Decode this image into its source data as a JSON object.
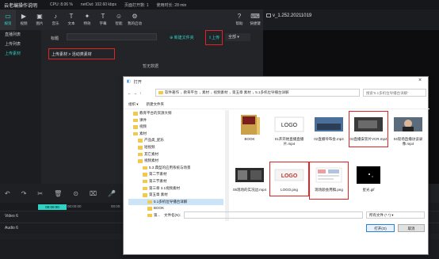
{
  "statusbar": {
    "app_title": "云老编操作说明",
    "cpu": "CPU: 8.06 %",
    "net": "netOut: 102.60 kbps",
    "fps": "页面打开数: 1",
    "time": "使用时长: 28 min"
  },
  "toolbar": {
    "items": [
      {
        "label": "媒资",
        "icon": "media-icon"
      },
      {
        "label": "视频",
        "icon": "video-icon"
      },
      {
        "label": "图片",
        "icon": "image-icon"
      },
      {
        "label": "音乐",
        "icon": "music-icon"
      },
      {
        "label": "文本",
        "icon": "text-icon"
      },
      {
        "label": "特效",
        "icon": "effect-icon"
      },
      {
        "label": "字幕",
        "icon": "subtitle-icon"
      },
      {
        "label": "智能",
        "icon": "ai-icon"
      },
      {
        "label": "我的启动",
        "icon": "start-icon"
      }
    ],
    "help": "帮助",
    "shortcut": "快捷键"
  },
  "preview": {
    "version": "v_1.252.20211019"
  },
  "sidebar": {
    "items": [
      {
        "label": "直播列表",
        "active": false
      },
      {
        "label": "上传列表",
        "active": false
      },
      {
        "label": "上传素材",
        "active": true
      }
    ]
  },
  "main": {
    "title_label": "标题",
    "new_folder": "新建文件夹",
    "upload": "上传",
    "filter": "全部",
    "breadcrumb": "上传素材 > 活动类素材",
    "no_data": "暂无数据"
  },
  "timeline": {
    "time_current": "00:00:00",
    "time_total": "00:00:00",
    "ruler_mark": "00:00:",
    "tracks": [
      "Video 6",
      "Audio 6"
    ]
  },
  "dialog": {
    "title": "打开",
    "path": [
      "软件著作",
      "教育平台",
      "素材",
      "视频素材",
      "第五章 素材",
      "5.1多机位导播台详解"
    ],
    "search_placeholder": "搜索'5.1多机位导播台详解'",
    "organize": "组织 ▾",
    "new_folder": "新建文件夹",
    "nav_items": [
      {
        "label": "教育平台的资源大纲",
        "indent": 2
      },
      {
        "label": "课件",
        "indent": 2
      },
      {
        "label": "视频",
        "indent": 2
      },
      {
        "label": "素材",
        "indent": 2
      },
      {
        "label": "产品类_配乐",
        "indent": 3
      },
      {
        "label": "短视频",
        "indent": 3
      },
      {
        "label": "其它素材",
        "indent": 3
      },
      {
        "label": "视频素材",
        "indent": 3
      },
      {
        "label": "5.3 典型的应用系统与场景",
        "indent": 4
      },
      {
        "label": "第二节素材",
        "indent": 4
      },
      {
        "label": "第三节素材",
        "indent": 4
      },
      {
        "label": "第三章 3.1视频素材",
        "indent": 4
      },
      {
        "label": "第五章 素材",
        "indent": 4
      },
      {
        "label": "5.1多机位导播台详解",
        "indent": 5,
        "selected": true
      },
      {
        "label": "BOOK",
        "indent": 5
      },
      {
        "label": "第...",
        "indent": 5
      }
    ],
    "files": [
      {
        "name": "BOOK",
        "kind": "folder"
      },
      {
        "name": "01开开始直播直播片.mp4",
        "kind": "video"
      },
      {
        "name": "02直播导布会.mp4",
        "kind": "video"
      },
      {
        "name": "03直播安装片VCR.mp4",
        "kind": "video",
        "highlight": true
      },
      {
        "name": "04现场直播访谈录像.mp4",
        "kind": "video"
      },
      {
        "name": "05现场的实况边.mp4",
        "kind": "video"
      },
      {
        "name": "LOGO.png",
        "kind": "logo",
        "highlight": true
      },
      {
        "name": "现场颜会用稿.png",
        "kind": "doc",
        "highlight": true
      },
      {
        "name": "星光.gif",
        "kind": "gif"
      }
    ],
    "filename_label": "文件名(N):",
    "filetype": "所有文件 (*.*)",
    "open": "打开(O)",
    "cancel": "取消"
  }
}
